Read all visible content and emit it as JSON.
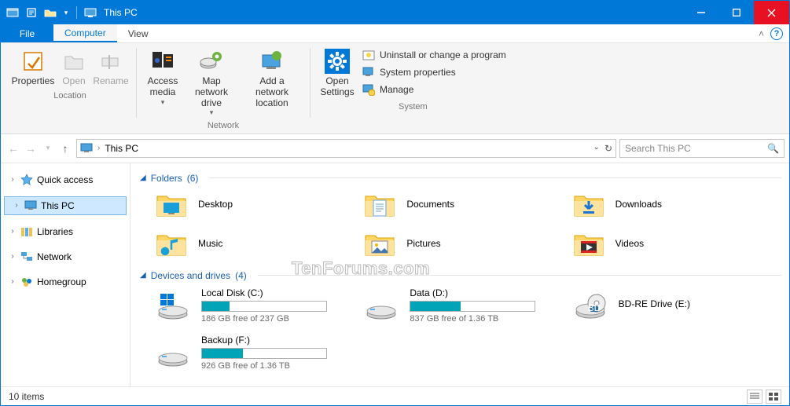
{
  "window": {
    "title": "This PC"
  },
  "menutabs": {
    "file": "File",
    "computer": "Computer",
    "view": "View"
  },
  "ribbon": {
    "location": {
      "label": "Location",
      "properties": "Properties",
      "open": "Open",
      "rename": "Rename"
    },
    "network": {
      "label": "Network",
      "access_media": "Access media",
      "map_drive": "Map network drive",
      "add_location": "Add a network location"
    },
    "settings": {
      "open_settings": "Open Settings"
    },
    "system": {
      "label": "System",
      "uninstall": "Uninstall or change a program",
      "sysprops": "System properties",
      "manage": "Manage"
    }
  },
  "address": {
    "crumb": "This PC",
    "refresh_tip": "Refresh",
    "dropdown_tip": "Previous Locations"
  },
  "search": {
    "placeholder": "Search This PC"
  },
  "tree": {
    "quick_access": "Quick access",
    "this_pc": "This PC",
    "libraries": "Libraries",
    "network": "Network",
    "homegroup": "Homegroup"
  },
  "sections": {
    "folders": {
      "title": "Folders",
      "count": "(6)"
    },
    "drives": {
      "title": "Devices and drives",
      "count": "(4)"
    }
  },
  "folders": [
    {
      "name": "Desktop"
    },
    {
      "name": "Documents"
    },
    {
      "name": "Downloads"
    },
    {
      "name": "Music"
    },
    {
      "name": "Pictures"
    },
    {
      "name": "Videos"
    }
  ],
  "drives": [
    {
      "name": "Local Disk (C:)",
      "free": "186 GB free of 237 GB",
      "fill_pct": 22,
      "kind": "os"
    },
    {
      "name": "Data (D:)",
      "free": "837 GB free of 1.36 TB",
      "fill_pct": 40,
      "kind": "hdd"
    },
    {
      "name": "BD-RE Drive (E:)",
      "free": "",
      "fill_pct": null,
      "kind": "optical"
    },
    {
      "name": "Backup (F:)",
      "free": "926 GB free of 1.36 TB",
      "fill_pct": 33,
      "kind": "hdd"
    }
  ],
  "status": {
    "text": "10 items"
  },
  "watermark": "TenForums.com"
}
